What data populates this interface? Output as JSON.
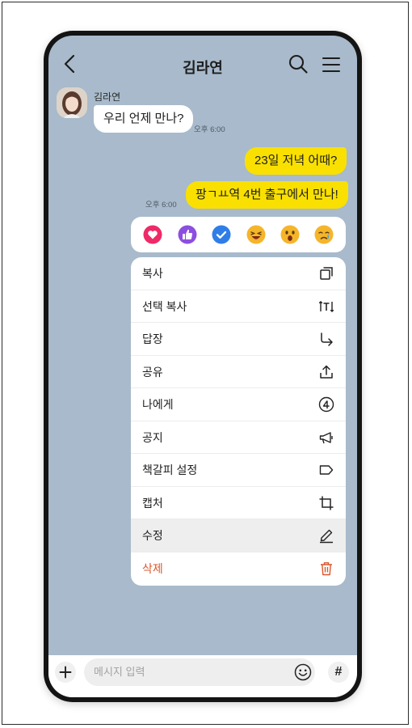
{
  "chat": {
    "title": "김라연",
    "sender_name": "김라연"
  },
  "messages": [
    {
      "text": "우리 언제 만나?",
      "direction": "incoming"
    },
    {
      "text": "오후 6:00",
      "role": "timestamp"
    },
    {
      "text": "23일 저녁 어때?",
      "direction": "outgoing"
    },
    {
      "text": "팡ㄱㅛ역 4번 출구에서 만나!",
      "direction": "outgoing"
    },
    {
      "text": "오후 6:00",
      "role": "timestamp"
    }
  ],
  "reactions": [
    {
      "name": "heart",
      "color": "#ee2a68"
    },
    {
      "name": "thumbs-up",
      "color": "#8c4fe0"
    },
    {
      "name": "check",
      "color": "#2f7ee8"
    },
    {
      "name": "laughing",
      "color": "#f5b52b"
    },
    {
      "name": "surprised",
      "color": "#f5b52b"
    },
    {
      "name": "crying",
      "color": "#f5b52b"
    }
  ],
  "context_menu": {
    "items": [
      {
        "label": "복사",
        "icon": "copy-icon"
      },
      {
        "label": "선택 복사",
        "icon": "select-text-icon"
      },
      {
        "label": "답장",
        "icon": "reply-arrow-icon"
      },
      {
        "label": "공유",
        "icon": "share-icon"
      },
      {
        "label": "나에게",
        "icon": "to-me-icon"
      },
      {
        "label": "공지",
        "icon": "megaphone-icon"
      },
      {
        "label": "책갈피 설정",
        "icon": "bookmark-tag-icon"
      },
      {
        "label": "캡처",
        "icon": "crop-icon"
      },
      {
        "label": "수정",
        "icon": "pencil-icon"
      },
      {
        "label": "삭제",
        "icon": "trash-icon"
      }
    ]
  },
  "input_bar": {
    "placeholder": "메시지 입력",
    "hash_label": "#"
  },
  "colors": {
    "background": "#a8bacb",
    "outgoing_bubble": "#f9e000",
    "incoming_bubble": "#ffffff",
    "delete": "#d9572b"
  }
}
